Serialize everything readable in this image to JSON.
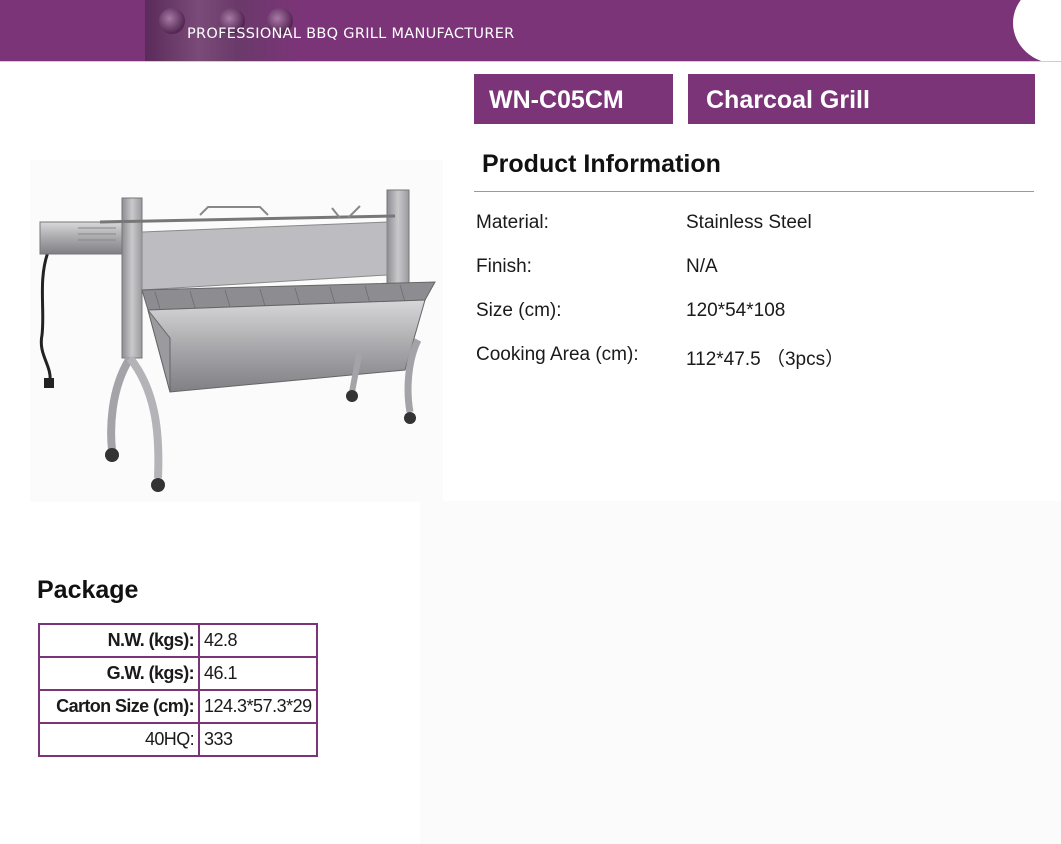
{
  "header": {
    "tagline": "PROFESSIONAL BBQ GRILL MANUFACTURER",
    "band_color": "#7b3478"
  },
  "product": {
    "model": "WN-C05CM",
    "type": "Charcoal Grill",
    "image": "charcoal rotisserie spit grill with electric motor"
  },
  "product_information": {
    "title": "Product Information",
    "rows": [
      {
        "label": "Material:",
        "value": "Stainless Steel"
      },
      {
        "label": "Finish:",
        "value": "N/A"
      },
      {
        "label": "Size (cm):",
        "value": "120*54*108"
      },
      {
        "label": "Cooking Area (cm):",
        "value": "112*47.5 （3pcs）"
      }
    ]
  },
  "package": {
    "title": "Package",
    "rows": [
      {
        "label": "N.W. (kgs):",
        "value": "42.8"
      },
      {
        "label": "G.W. (kgs):",
        "value": "46.1"
      },
      {
        "label": "Carton Size (cm):",
        "value": "124.3*57.3*29"
      },
      {
        "label": "40HQ:",
        "value": "333"
      }
    ]
  }
}
